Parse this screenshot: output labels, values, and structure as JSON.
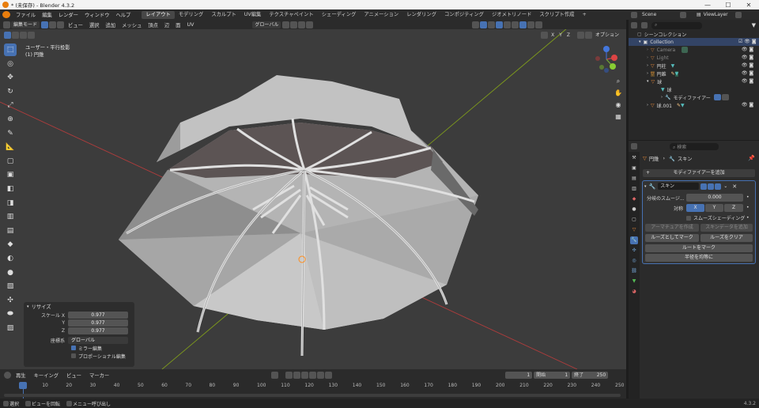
{
  "window": {
    "title": "* (未保存) - Blender 4.3.2",
    "controls": [
      "—",
      "☐",
      "✕"
    ]
  },
  "menu": {
    "items": [
      "ファイル",
      "編集",
      "レンダー",
      "ウィンドウ",
      "ヘルプ"
    ],
    "workspaces": [
      "レイアウト",
      "モデリング",
      "スカルプト",
      "UV編集",
      "テクスチャペイント",
      "シェーディング",
      "アニメーション",
      "レンダリング",
      "コンポジティング",
      "ジオメトリノード",
      "スクリプト作成"
    ],
    "add_workspace": "+"
  },
  "viewport_header": {
    "mode": "編集モード",
    "menus": [
      "ビュー",
      "選択",
      "追加",
      "メッシュ",
      "頂点",
      "辺",
      "面",
      "UV"
    ],
    "orientation": "グローバル",
    "options": "オプション",
    "axes": [
      "X",
      "Y",
      "Z"
    ]
  },
  "viewport": {
    "view_name": "ユーザー・平行投影",
    "object_name": "(1) 円錐"
  },
  "redo_panel": {
    "title": "リサイズ",
    "scale_label": "スケール X",
    "y_label": "Y",
    "z_label": "Z",
    "scale_x": "0.977",
    "scale_y": "0.977",
    "scale_z": "0.977",
    "orientation_label": "座標系",
    "orientation_value": "グローバル",
    "mirror_edit": "ミラー編集",
    "proportional_edit": "プロポーショナル編集"
  },
  "timeline": {
    "menus": [
      "再生",
      "キーイング",
      "ビュー",
      "マーカー"
    ],
    "current_frame": "1",
    "start_label": "開始",
    "start": "1",
    "end_label": "終了",
    "end": "250",
    "ticks": [
      "1",
      "10",
      "20",
      "30",
      "40",
      "50",
      "60",
      "70",
      "80",
      "90",
      "100",
      "110",
      "120",
      "130",
      "140",
      "150",
      "160",
      "170",
      "180",
      "190",
      "200",
      "210",
      "220",
      "230",
      "240",
      "250"
    ]
  },
  "statusbar": {
    "select": "選択",
    "rotate": "ビューを回転",
    "menu": "メニュー呼び出し",
    "version": "4.3.2"
  },
  "outliner": {
    "scene": "Scene",
    "view_layer": "ViewLayer",
    "root": "シーンコレクション",
    "items": [
      {
        "name": "Collection",
        "depth": 1
      },
      {
        "name": "Camera",
        "depth": 2
      },
      {
        "name": "Light",
        "depth": 2
      },
      {
        "name": "円柱",
        "depth": 2
      },
      {
        "name": "円錐",
        "depth": 2
      },
      {
        "name": "球",
        "depth": 2
      },
      {
        "name": "球",
        "depth": 3
      },
      {
        "name": "モディファイアー",
        "depth": 3
      },
      {
        "name": "球.001",
        "depth": 2
      }
    ]
  },
  "properties": {
    "object": "円錐",
    "modifier_crumb": "スキン",
    "add_modifier": "モディファイアーを追加",
    "modifier_name": "スキン",
    "branch_smooth_label": "分岐のスムージ...",
    "branch_smooth_value": "0.000",
    "symmetry_label": "対称",
    "smooth_shading": "スムーズシェーディング",
    "create_armature": "アーマチュアを作成",
    "add_skin_data": "スキンデータを追加",
    "mark_loose": "ルーズとしてマーク",
    "clear_loose": "ルーズをクリア",
    "mark_root": "ルートをマーク",
    "equalize_radii": "半径を均等に"
  }
}
